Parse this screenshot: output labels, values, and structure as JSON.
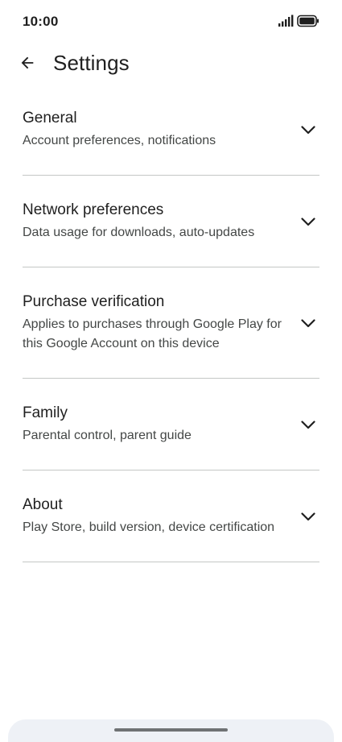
{
  "status_bar": {
    "time": "10:00",
    "signal_icon": "signal-icon",
    "battery_icon": "battery-icon"
  },
  "app_bar": {
    "back_icon": "arrow-back-icon",
    "title": "Settings"
  },
  "sections": [
    {
      "title": "General",
      "subtitle": "Account preferences, notifications"
    },
    {
      "title": "Network preferences",
      "subtitle": "Data usage for downloads, auto-updates"
    },
    {
      "title": "Purchase verification",
      "subtitle": "Applies to purchases through Google Play for this Google Account on this device"
    },
    {
      "title": "Family",
      "subtitle": "Parental control, parent guide"
    },
    {
      "title": "About",
      "subtitle": "Play Store, build version, device certification"
    }
  ],
  "colors": {
    "text_primary": "#1f1f1f",
    "text_secondary": "#444746",
    "divider": "#c4c7c5",
    "nav_bar": "#eef1f6"
  }
}
